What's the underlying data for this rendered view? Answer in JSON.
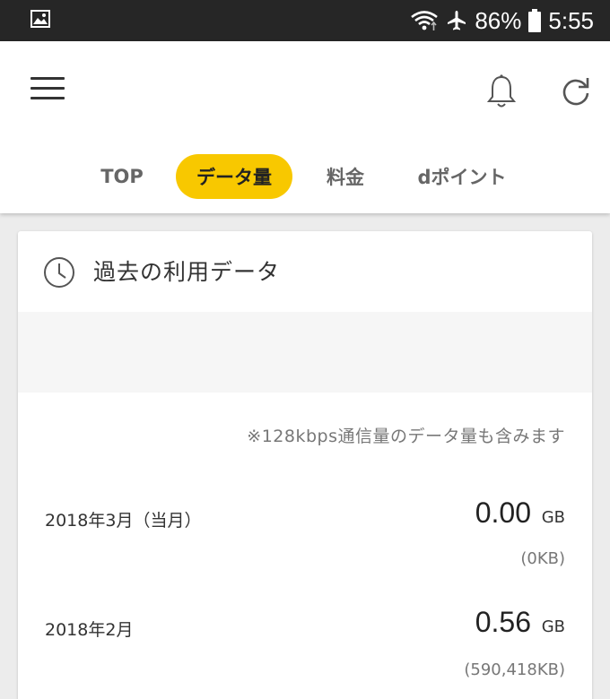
{
  "status_bar": {
    "icons": [
      "image-notification-icon",
      "wifi-icon",
      "airplane-mode-icon",
      "battery-icon"
    ],
    "battery": "86%",
    "time": "5:55"
  },
  "header": {
    "icons": [
      "menu-icon",
      "bell-icon",
      "refresh-icon"
    ]
  },
  "tabs": [
    {
      "label": "TOP",
      "active": false
    },
    {
      "label": "データ量",
      "active": true
    },
    {
      "label": "料金",
      "active": false
    },
    {
      "label": "dポイント",
      "active": false
    }
  ],
  "colors": {
    "accent": "#f8c800",
    "status_bar": "#262626",
    "background": "#ececec"
  },
  "card": {
    "icon": "clock-icon",
    "title": "過去の利用データ",
    "note": "※128kbps通信量のデータ量も含みます",
    "rows": [
      {
        "month": "2018年3月（当月）",
        "value": "0.00",
        "unit": "GB",
        "kb": "(0KB)"
      },
      {
        "month": "2018年2月",
        "value": "0.56",
        "unit": "GB",
        "kb": "(590,418KB)"
      }
    ]
  }
}
